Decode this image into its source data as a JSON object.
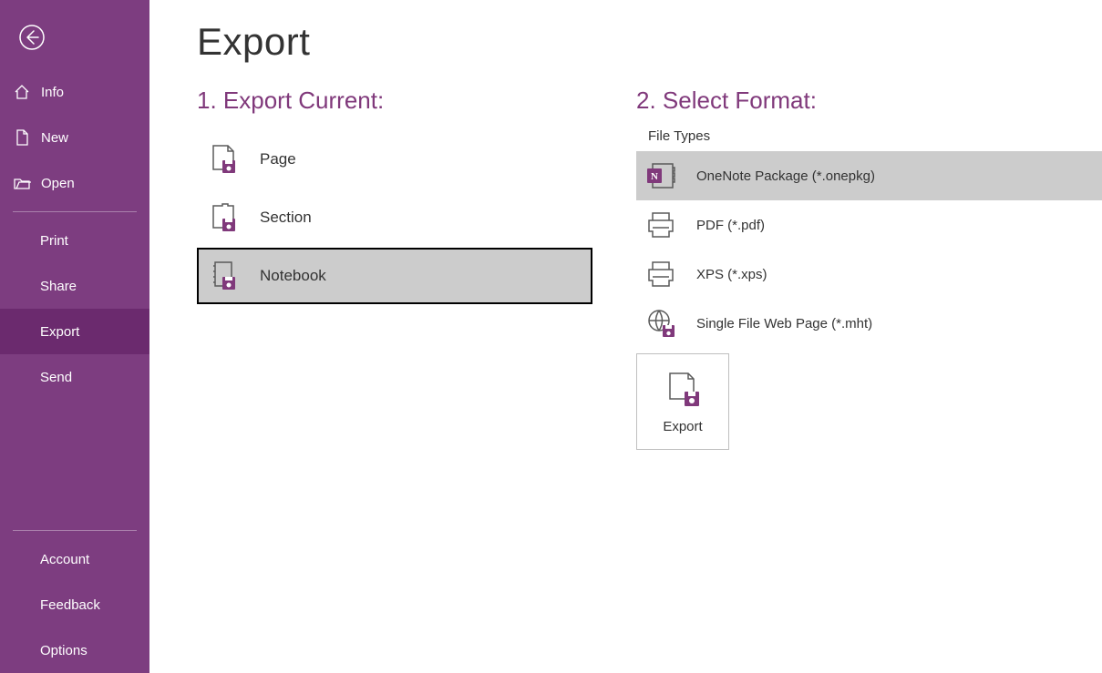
{
  "accent": "#80397b",
  "sidebar": {
    "items_top": [
      {
        "id": "info",
        "label": "Info",
        "icon": "home"
      },
      {
        "id": "new",
        "label": "New",
        "icon": "doc"
      },
      {
        "id": "open",
        "label": "Open",
        "icon": "folder"
      }
    ],
    "items_mid": [
      {
        "id": "print",
        "label": "Print"
      },
      {
        "id": "share",
        "label": "Share"
      },
      {
        "id": "export",
        "label": "Export",
        "selected": true
      },
      {
        "id": "send",
        "label": "Send"
      }
    ],
    "items_bottom": [
      {
        "id": "account",
        "label": "Account"
      },
      {
        "id": "feedback",
        "label": "Feedback"
      },
      {
        "id": "options",
        "label": "Options"
      }
    ]
  },
  "page": {
    "title": "Export",
    "step1_heading": "1. Export Current:",
    "step2_heading": "2. Select Format:",
    "file_types_label": "File Types",
    "scopes": [
      {
        "id": "page",
        "label": "Page"
      },
      {
        "id": "section",
        "label": "Section"
      },
      {
        "id": "notebook",
        "label": "Notebook",
        "selected": true
      }
    ],
    "formats": [
      {
        "id": "onepkg",
        "label": "OneNote Package (*.onepkg)",
        "selected": true
      },
      {
        "id": "pdf",
        "label": "PDF (*.pdf)"
      },
      {
        "id": "xps",
        "label": "XPS (*.xps)"
      },
      {
        "id": "mht",
        "label": "Single File Web Page (*.mht)"
      }
    ],
    "export_button_label": "Export"
  }
}
